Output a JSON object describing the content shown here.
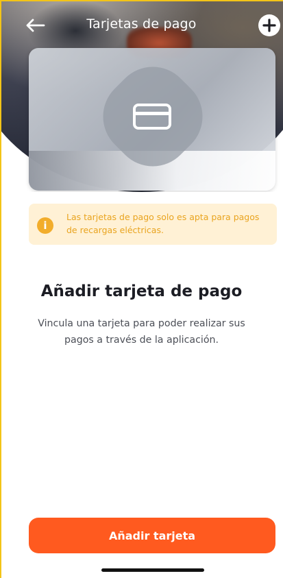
{
  "header": {
    "title": "Tarjetas de pago",
    "back_icon": "arrow-left-icon",
    "add_icon": "plus-circle-icon"
  },
  "hero": {
    "icon": "credit-card-icon"
  },
  "info": {
    "icon": "info-icon",
    "icon_glyph": "i",
    "text": "Las tarjetas de pago solo es apta para pagos de recargas eléctricas."
  },
  "main": {
    "heading": "Añadir tarjeta de pago",
    "description": "Vincula una tarjeta para poder realizar sus pagos a través de la aplicación."
  },
  "cta": {
    "label": "Añadir tarjeta"
  },
  "colors": {
    "accent": "#ff5a1f",
    "info_bg": "#fff1d5",
    "info_text": "#e9a41f",
    "info_icon": "#f2ad2b"
  }
}
